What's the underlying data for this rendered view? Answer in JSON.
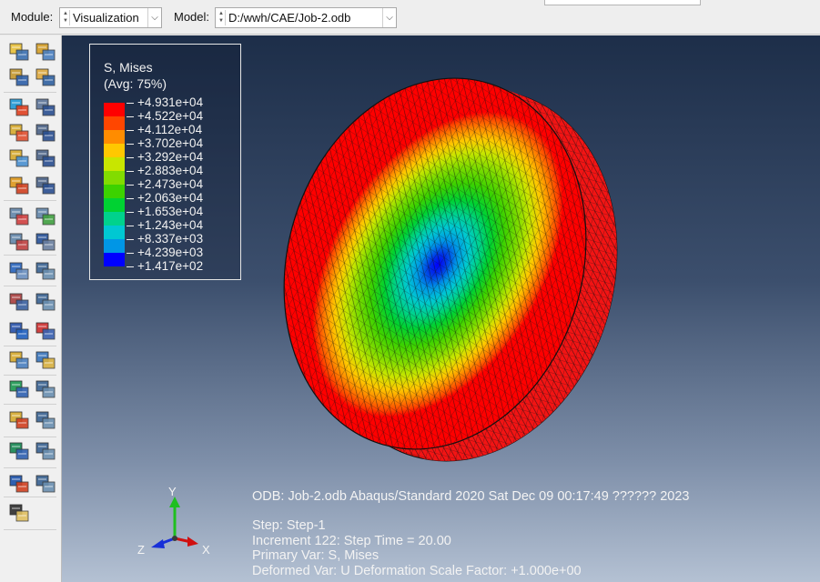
{
  "context_bar": {
    "module_label": "Module:",
    "module_value": "Visualization",
    "model_label": "Model:",
    "model_value": "D:/wwh/CAE/Job-2.odb"
  },
  "toolbox": {
    "icons": [
      "probe-values-icon",
      "query-options-icon",
      "plot-undeformed-icon",
      "plot-deformed-icon",
      "plot-contours-icon",
      "contour-options-icon",
      "plot-symbols-icon",
      "symbol-options-icon",
      "plot-material-orientations-icon",
      "orientation-options-icon",
      "allow-multiple-plot-states-icon",
      "superimpose-options-icon",
      "animate-scale-factor-icon",
      "animate-time-history-icon",
      "animate-harmonic-icon",
      "animation-options-icon",
      "view-cut-icon",
      "view-cut-manager-icon",
      "create-xy-data-icon",
      "xy-data-manager-icon",
      "create-path-icon",
      "path-plot-icon",
      "free-body-cut-icon",
      "free-body-manager-icon",
      "stream-icon",
      "stream-manager-icon",
      "display-group-icon",
      "display-group-manager-icon",
      "ply-stack-plot-icon",
      "ply-stack-manager-icon",
      "color-code-icon",
      "color-code-manager-icon",
      "common-options-icon"
    ]
  },
  "legend": {
    "variable": "S, Mises",
    "averaging": "(Avg: 75%)",
    "entries": [
      {
        "value": "+4.931e+04",
        "color": "#ff0000"
      },
      {
        "value": "+4.522e+04",
        "color": "#ff4600"
      },
      {
        "value": "+4.112e+04",
        "color": "#ff8c00"
      },
      {
        "value": "+3.702e+04",
        "color": "#ffc800"
      },
      {
        "value": "+3.292e+04",
        "color": "#c8e600"
      },
      {
        "value": "+2.883e+04",
        "color": "#82dc00"
      },
      {
        "value": "+2.473e+04",
        "color": "#3cd200"
      },
      {
        "value": "+2.063e+04",
        "color": "#00d232"
      },
      {
        "value": "+1.653e+04",
        "color": "#00d28c"
      },
      {
        "value": "+1.243e+04",
        "color": "#00c8d2"
      },
      {
        "value": "+8.337e+03",
        "color": "#0096e6"
      },
      {
        "value": "+4.239e+03",
        "color": "#0050e6"
      },
      {
        "value": "+1.417e+02",
        "color": "#0000ff"
      }
    ]
  },
  "info": {
    "odb_line": "ODB: Job-2.odb    Abaqus/Standard 2020    Sat Dec 09 00:17:49 ?????? 2023",
    "step_line": "Step: Step-1",
    "increment_line": "Increment     122: Step Time =     20.00",
    "primary_var_line": "Primary Var: S, Mises",
    "deformed_var_line": "Deformed Var: U   Deformation Scale Factor: +1.000e+00"
  },
  "triad": {
    "x_label": "X",
    "y_label": "Y",
    "z_label": "Z"
  }
}
